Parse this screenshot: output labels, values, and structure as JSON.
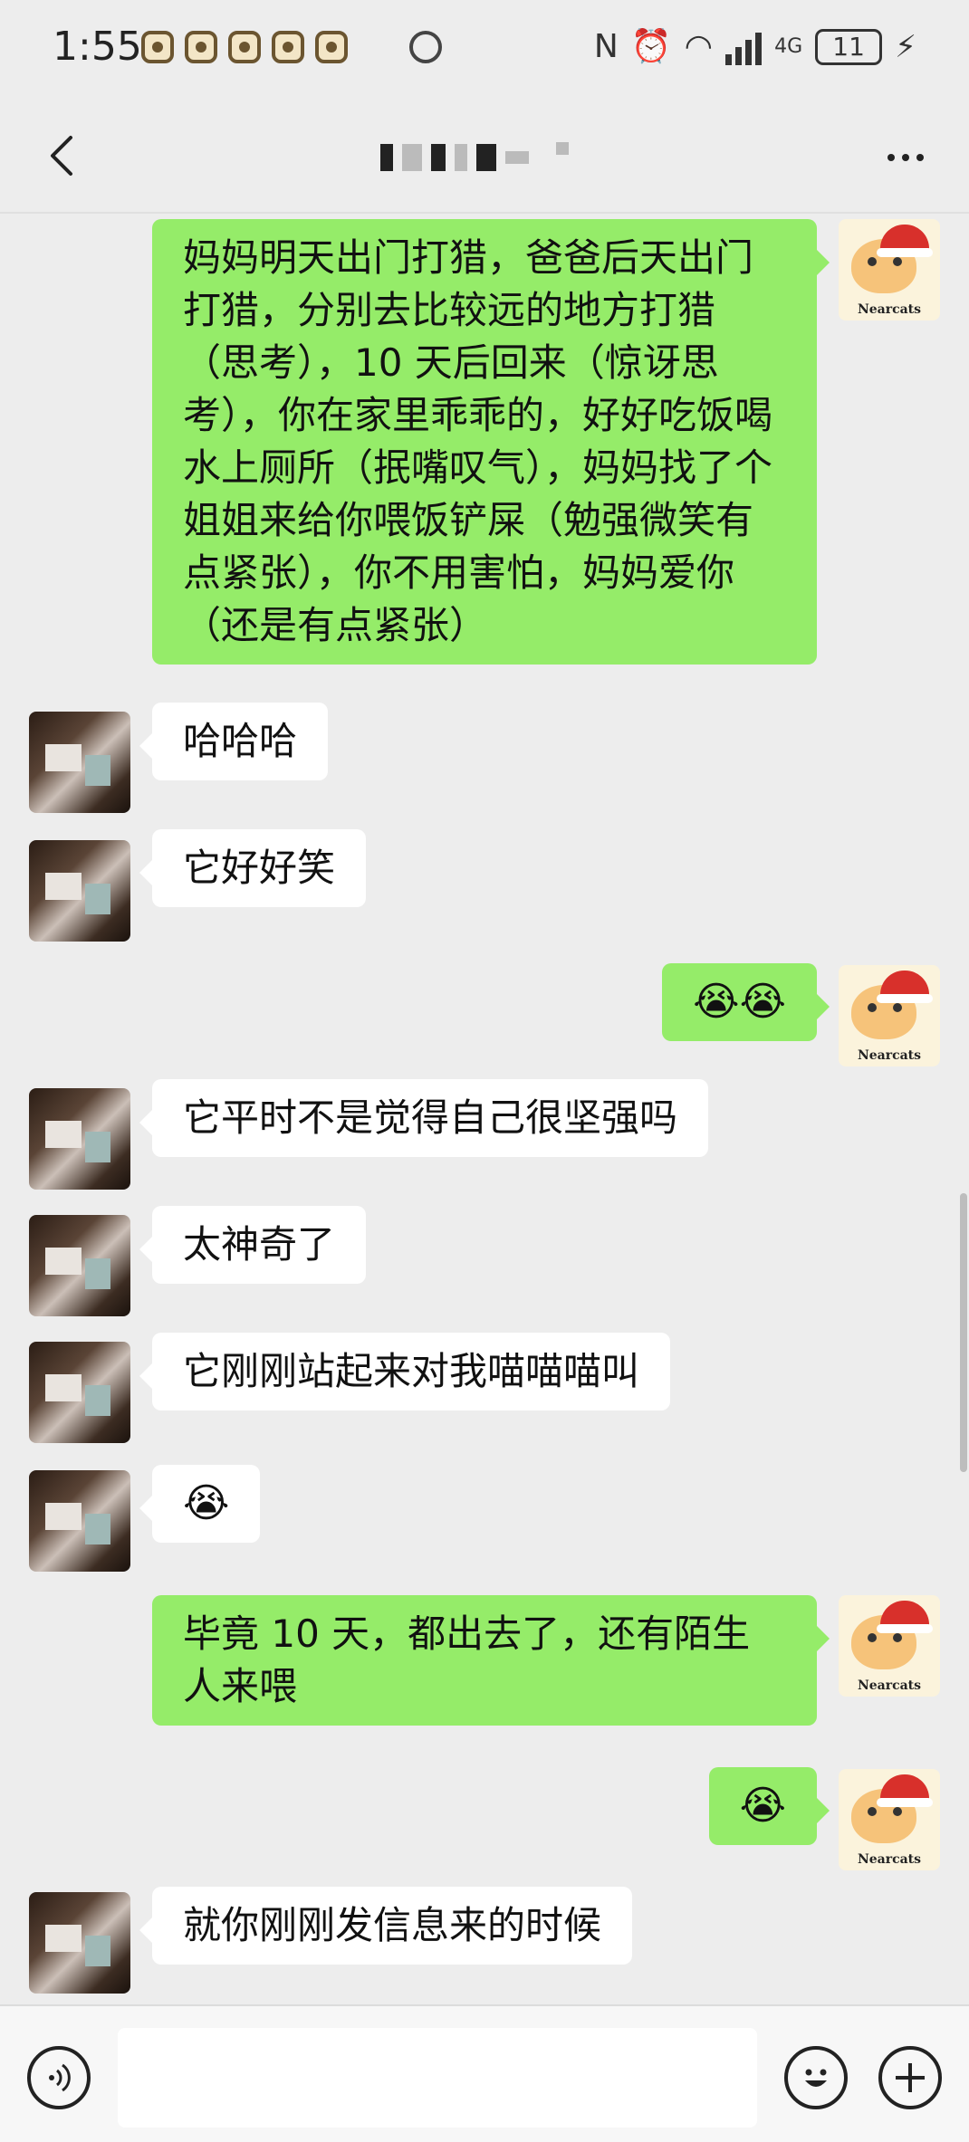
{
  "status_bar": {
    "time": "1:55",
    "battery": "11",
    "network": "4G",
    "icons": [
      "app-notification-icon",
      "app-notification-icon",
      "app-notification-icon",
      "app-notification-icon",
      "app-notification-icon",
      "sync-icon",
      "nfc-icon",
      "alarm-icon",
      "wifi-icon",
      "signal-icon",
      "battery-icon",
      "charging-icon"
    ]
  },
  "header": {
    "title": "",
    "back_icon": "chevron-left-icon",
    "more_icon": "more-dots-icon"
  },
  "messages": [
    {
      "side": "right",
      "text": "妈妈明天出门打猎，爸爸后天出门打猎，分别去比较远的地方打猎（思考），10 天后回来（惊讶思考），你在家里乖乖的，好好吃饭喝水上厕所（抿嘴叹气），妈妈找了个姐姐来给你喂饭铲屎（勉强微笑有点紧张），你不用害怕，妈妈爱你（还是有点紧张）"
    },
    {
      "side": "left",
      "text": "哈哈哈"
    },
    {
      "side": "left",
      "text": "它好好笑"
    },
    {
      "side": "right",
      "text": "😭😭"
    },
    {
      "side": "left",
      "text": "它平时不是觉得自己很坚强吗"
    },
    {
      "side": "left",
      "text": "太神奇了"
    },
    {
      "side": "left",
      "text": "它刚刚站起来对我喵喵喵叫"
    },
    {
      "side": "left",
      "text": "😭"
    },
    {
      "side": "right",
      "text": "毕竟 10 天，都出去了，还有陌生人来喂"
    },
    {
      "side": "right",
      "text": "😭"
    },
    {
      "side": "left",
      "text": "就你刚刚发信息来的时候"
    }
  ],
  "self_avatar_label": "Nearcats",
  "input_bar": {
    "placeholder": "",
    "voice_icon": "voice-icon",
    "emoji_icon": "emoji-icon",
    "plus_icon": "plus-icon"
  }
}
